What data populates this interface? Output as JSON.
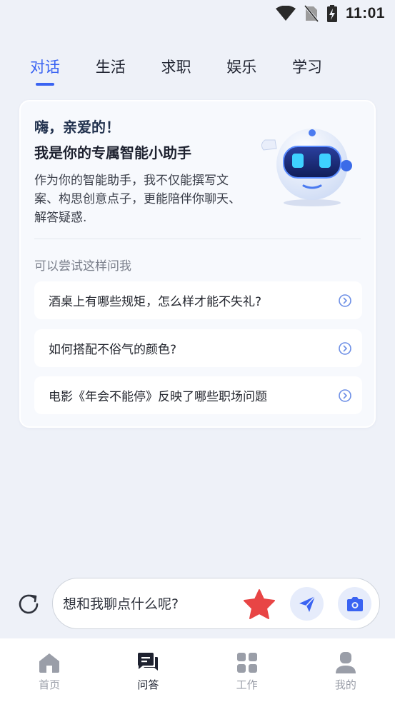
{
  "status_bar": {
    "time": "11:01",
    "icons": [
      "wifi-icon",
      "no-sim-icon",
      "battery-charging-icon"
    ]
  },
  "tabs": [
    {
      "label": "对话",
      "active": true
    },
    {
      "label": "生活",
      "active": false
    },
    {
      "label": "求职",
      "active": false
    },
    {
      "label": "娱乐",
      "active": false
    },
    {
      "label": "学习",
      "active": false
    }
  ],
  "intro": {
    "greeting": "嗨，亲爱的！",
    "subtitle": "我是你的专属智能小助手",
    "description": "作为你的智能助手，我不仅能撰写文案、构思创意点子，更能陪伴你聊天、解答疑惑.",
    "mascot": "robot-mascot-icon"
  },
  "suggestions": {
    "heading": "可以尝试这样问我",
    "items": [
      {
        "text": "酒桌上有哪些规矩，怎么样才能不失礼?"
      },
      {
        "text": "如何搭配不俗气的颜色?"
      },
      {
        "text": "电影《年会不能停》反映了哪些职场问题"
      }
    ]
  },
  "chat_input": {
    "placeholder": "想和我聊点什么呢?",
    "value": ""
  },
  "bottom_nav": [
    {
      "label": "首页",
      "icon": "home-icon",
      "active": false
    },
    {
      "label": "问答",
      "icon": "chat-icon",
      "active": true
    },
    {
      "label": "工作",
      "icon": "grid-icon",
      "active": false
    },
    {
      "label": "我的",
      "icon": "user-icon",
      "active": false
    }
  ],
  "colors": {
    "accent": "#3a63f2",
    "background": "#eef1f8",
    "star": "#e84545",
    "inactive_icon": "#9a9ea8",
    "active_icon": "#1e2230"
  }
}
